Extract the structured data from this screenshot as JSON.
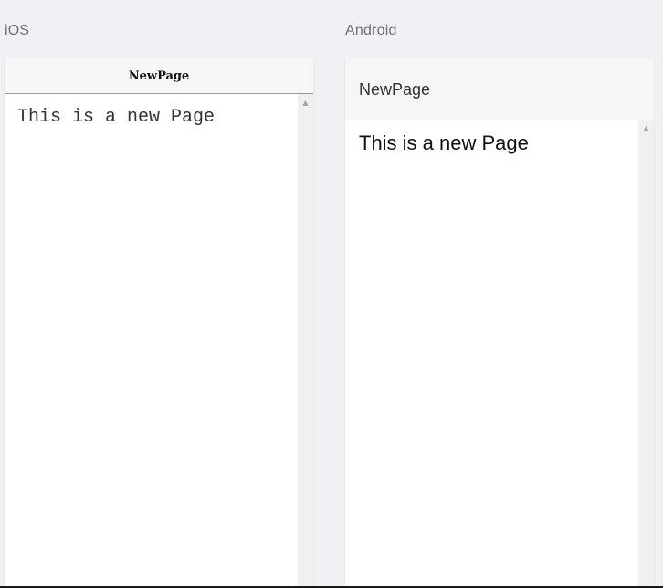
{
  "ios": {
    "platform_label": "iOS",
    "nav_title": "NewPage",
    "body_text": "This is a new Page"
  },
  "android": {
    "platform_label": "Android",
    "bar_title": "NewPage",
    "body_text": "This is a new Page"
  },
  "scroll_arrow_glyph": "▲",
  "colors": {
    "background": "#f0f1f5",
    "nav_background": "#f7f7f7",
    "scrollbar": "#f0f0f0"
  }
}
